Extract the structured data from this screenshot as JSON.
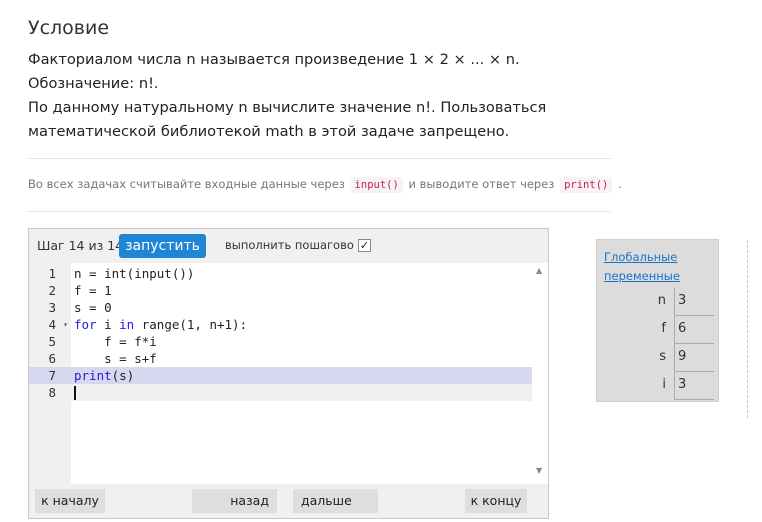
{
  "problem": {
    "title": "Условие",
    "paragraph1": "Факториалом числа n называется произведение 1 × 2 × ... × n. Обозначение: n!.",
    "paragraph2": "По данному натуральному n вычислите значение n!. Пользоваться математической библиотекой math в этой задаче запрещено."
  },
  "hint": {
    "part1": "Во всех задачах считывайте входные данные через",
    "input_code": "input()",
    "part2": "и выводите ответ через",
    "print_code": "print()",
    "part3": "."
  },
  "visualizer": {
    "step_label": "Шаг 14 из 14",
    "run_button": "запустить",
    "step_mode_label": "выполнить пошагово",
    "step_mode_checked": true,
    "highlight_line": 7,
    "code_lines": [
      {
        "num": "1",
        "text": "n = int(input())"
      },
      {
        "num": "2",
        "text": "f = 1"
      },
      {
        "num": "3",
        "text": "s = 0"
      },
      {
        "num": "4",
        "text": "for i in range(1, n+1):"
      },
      {
        "num": "5",
        "text": "    f = f*i"
      },
      {
        "num": "6",
        "text": "    s = s+f"
      },
      {
        "num": "7",
        "text": "print(s)"
      },
      {
        "num": "8",
        "text": ""
      }
    ],
    "nav": {
      "first": "к началу",
      "back": "назад",
      "forward": "дальше",
      "last": "к концу"
    }
  },
  "globals": {
    "title": "Глобальные переменные",
    "vars": [
      {
        "name": "n",
        "value": "3"
      },
      {
        "name": "f",
        "value": "6"
      },
      {
        "name": "s",
        "value": "9"
      },
      {
        "name": "i",
        "value": "3"
      }
    ]
  },
  "colors": {
    "accent": "#1f86d6",
    "link": "#1a73c9",
    "highlight": "#d7d7ef",
    "keyword": "#1a1ae6"
  }
}
